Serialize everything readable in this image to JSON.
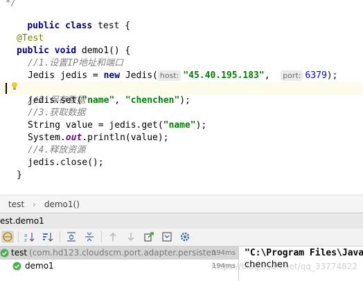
{
  "editor": {
    "line_top_fragment": " */",
    "class_decl": {
      "kw1": "public",
      "kw2": "class",
      "rest": " test {"
    },
    "annotation": "@Test",
    "method_decl": {
      "kw1": "public",
      "kw2": "void",
      "rest": " demo1() {"
    },
    "comment1": "//1.设置IP地址和端口",
    "jedis_decl": {
      "pre": "Jedis jedis = ",
      "kw": "new",
      "mid": " Jedis(",
      "hint_host": "host:",
      "host_value": "\"45.40.195.183\"",
      "comma": ",  ",
      "hint_port": "port:",
      "port_value": "6379",
      "end": ");"
    },
    "comment2": "//2.保存数据",
    "set_call": {
      "pre": "jedis.set(",
      "arg1": "\"name\"",
      "comma": ", ",
      "arg2": "\"chenchen\"",
      "end": ");"
    },
    "comment3": "//3.获取数据",
    "get_call": {
      "pre": "String value = jedis.get(",
      "arg": "\"name\"",
      "end": ");"
    },
    "println_call": {
      "pre": "System.",
      "field": "out",
      "post": ".println(value);"
    },
    "comment4": "//4.释放资源",
    "close_call": "jedis.close();",
    "close_brace": "}"
  },
  "breadcrumb": {
    "items": [
      "test",
      "demo1()"
    ]
  },
  "run_panel": {
    "title": "est.demo1",
    "tree": [
      {
        "label": "test",
        "detail": " (com.hd123.cloudscm.port.adapter.persisten",
        "duration": "194ms",
        "status": "passed"
      },
      {
        "label": "demo1",
        "duration": "194ms",
        "status": "passed"
      }
    ],
    "console": [
      "\"C:\\Program Files\\Java",
      "chenchen"
    ]
  },
  "toolbar": {
    "icons": [
      "run-history-icon",
      "sort-alpha-icon",
      "sort-duration-icon",
      "expand-all-icon",
      "collapse-all-icon",
      "previous-test-icon",
      "next-test-icon",
      "export-icon",
      "import-icon",
      "settings-icon"
    ]
  },
  "watermark": "https://blog.csdn.net/qq_33774822",
  "colors": {
    "keyword": "#000080",
    "string": "#008000",
    "comment": "#808080",
    "annotation": "#808000",
    "number": "#0000ff",
    "pass": "#4caf50"
  }
}
